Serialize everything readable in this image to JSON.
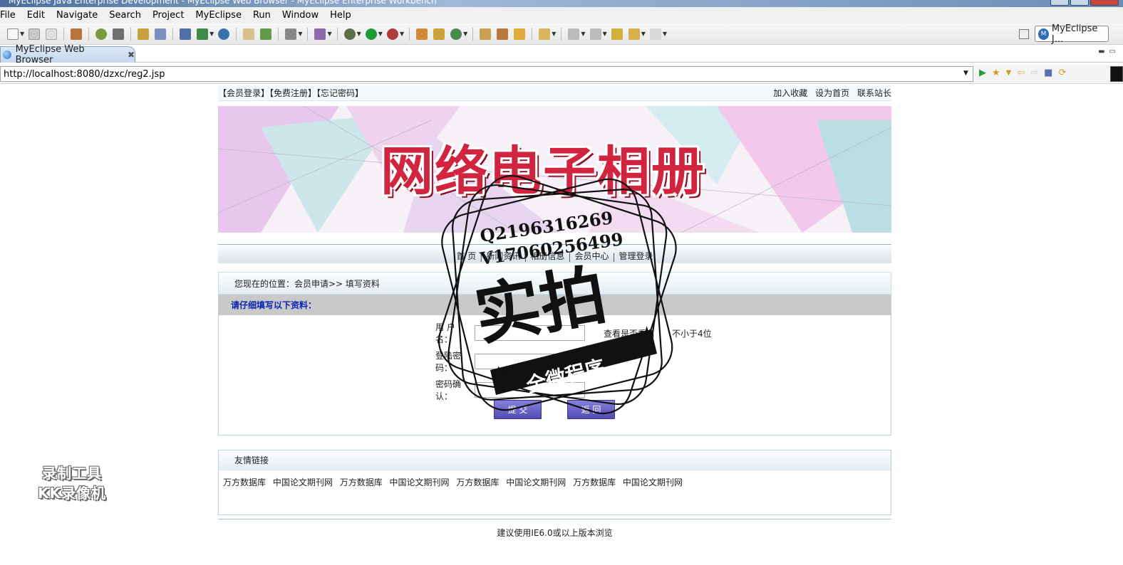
{
  "window": {
    "title": "MyEclipse Java Enterprise Development - MyEclipse Web Browser - MyEclipse Enterprise Workbench"
  },
  "menu": [
    "File",
    "Edit",
    "Navigate",
    "Search",
    "Project",
    "MyEclipse",
    "Run",
    "Window",
    "Help"
  ],
  "toolbar": {
    "perspective_label": "MyEclipse J..."
  },
  "editor_tab": {
    "label": "MyEclipse Web Browser",
    "close": "✖"
  },
  "url_bar": {
    "url": "http://localhost:8080/dzxc/reg2.jsp"
  },
  "site": {
    "top_left_links": [
      "【会员登录】",
      "【免费注册】",
      "【忘记密码】"
    ],
    "top_right_links": [
      "加入收藏",
      "设为首页",
      "联系站长"
    ],
    "banner_title": "网络电子相册",
    "nav": [
      "首 页",
      "新闻资讯",
      "相册信息",
      "会员中心",
      "管理登录"
    ],
    "breadcrumb": "您现在的位置：会员申请>> 填写资料",
    "form": {
      "heading": "请仔细填写以下资料：",
      "username_label": "用 户 名：",
      "username_value": "",
      "check_name_link": "查看是否重名",
      "username_hint": "不小于4位",
      "password_label": "登陆密码：",
      "password_value": "",
      "confirm_label": "密码确认：",
      "confirm_value": "",
      "submit_label": "提 交",
      "back_label": "返 回"
    },
    "friend_links": {
      "title": "友情链接",
      "items": [
        "万方数据库",
        "中国论文期刊网",
        "万方数据库",
        "中国论文期刊网",
        "万方数据库",
        "中国论文期刊网",
        "万方数据库",
        "中国论文期刊网"
      ]
    },
    "footer": "建议使用IE6.0或以上版本浏览"
  },
  "overlays": {
    "stamp_q": "Q2196316269",
    "stamp_v": "V17060256499",
    "stamp_big": "实拍",
    "stamp_ribbon": "全微程序",
    "recorder_line1": "录制工具",
    "recorder_line2": "KK录像机"
  },
  "colors": {
    "banner_title": "#d1243f",
    "form_heading": "#0b24b0",
    "button": "#5f58c2"
  }
}
